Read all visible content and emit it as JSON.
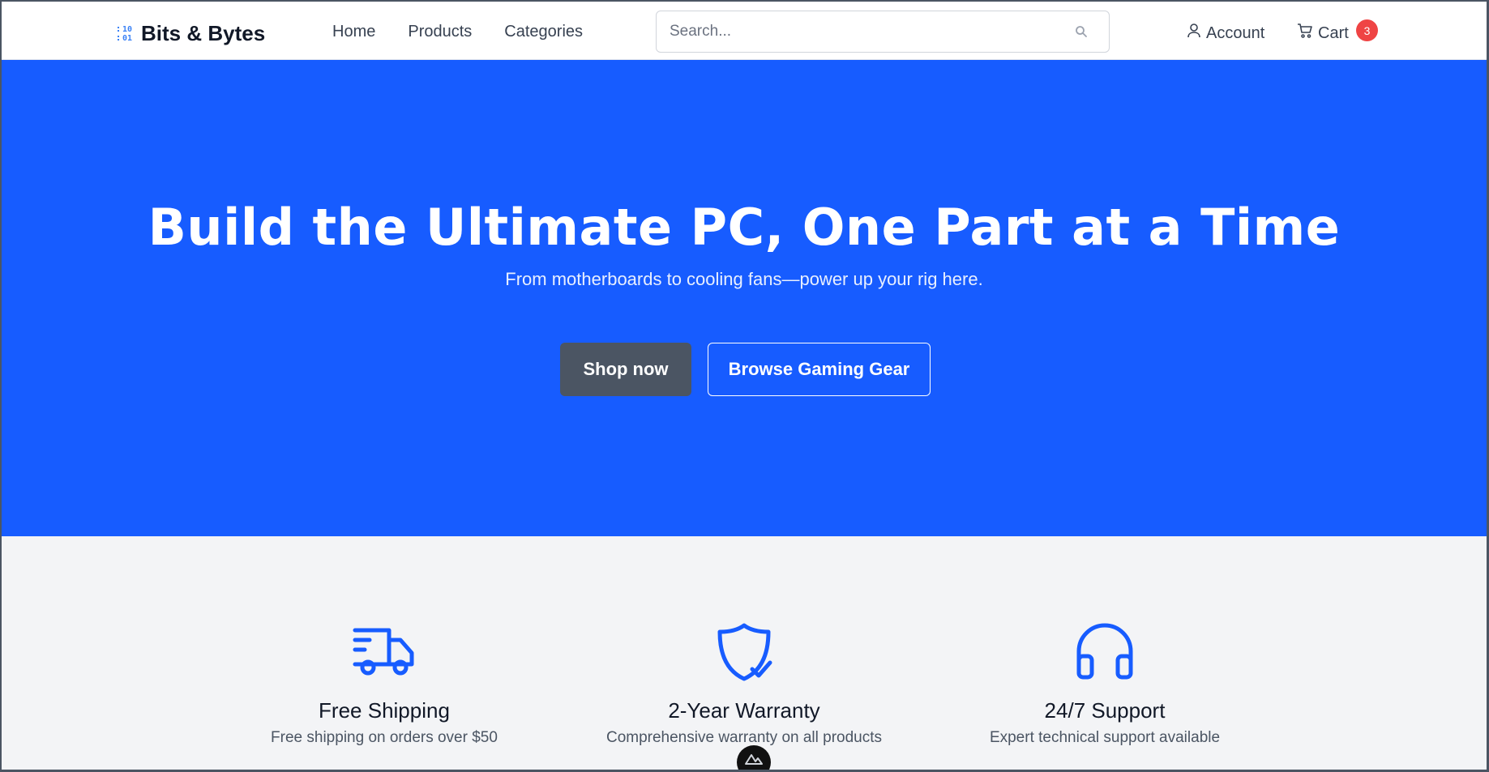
{
  "brand": {
    "icon_text": ":10\n:01",
    "name": "Bits & Bytes"
  },
  "nav": {
    "items": [
      {
        "label": "Home"
      },
      {
        "label": "Products"
      },
      {
        "label": "Categories"
      }
    ]
  },
  "search": {
    "placeholder": "Search...",
    "value": "",
    "icon": "search-icon"
  },
  "user": {
    "account_label": "Account",
    "cart_label": "Cart",
    "cart_count": "3"
  },
  "hero": {
    "title": "Build the Ultimate PC, One Part at a Time",
    "subtitle": "From motherboards to cooling fans—power up your rig here.",
    "primary_button": "Shop now",
    "secondary_button": "Browse Gaming Gear",
    "background_color": "#175cff"
  },
  "features": [
    {
      "icon": "truck-icon",
      "title": "Free Shipping",
      "description": "Free shipping on orders over $50"
    },
    {
      "icon": "shield-check-icon",
      "title": "2-Year Warranty",
      "description": "Comprehensive warranty on all products"
    },
    {
      "icon": "headphones-icon",
      "title": "24/7 Support",
      "description": "Expert technical support available"
    }
  ],
  "colors": {
    "accent": "#175cff",
    "badge": "#ef4444",
    "primary_button": "#4b5563"
  }
}
